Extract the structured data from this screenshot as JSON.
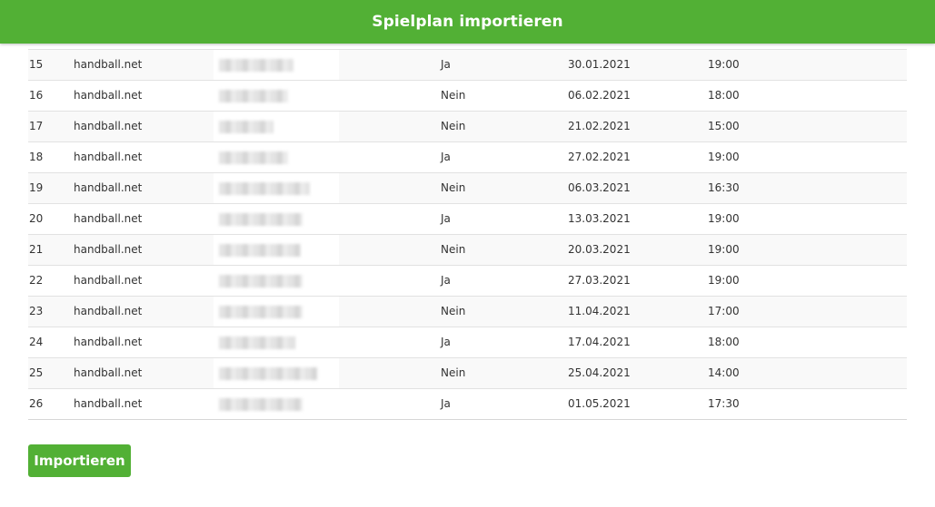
{
  "header": {
    "title": "Spielplan importieren"
  },
  "rows": [
    {
      "nr": "15",
      "source": "handball.net",
      "home": "Ja",
      "date": "30.01.2021",
      "time": "19:00"
    },
    {
      "nr": "16",
      "source": "handball.net",
      "home": "Nein",
      "date": "06.02.2021",
      "time": "18:00"
    },
    {
      "nr": "17",
      "source": "handball.net",
      "home": "Nein",
      "date": "21.02.2021",
      "time": "15:00"
    },
    {
      "nr": "18",
      "source": "handball.net",
      "home": "Ja",
      "date": "27.02.2021",
      "time": "19:00"
    },
    {
      "nr": "19",
      "source": "handball.net",
      "home": "Nein",
      "date": "06.03.2021",
      "time": "16:30"
    },
    {
      "nr": "20",
      "source": "handball.net",
      "home": "Ja",
      "date": "13.03.2021",
      "time": "19:00"
    },
    {
      "nr": "21",
      "source": "handball.net",
      "home": "Nein",
      "date": "20.03.2021",
      "time": "19:00"
    },
    {
      "nr": "22",
      "source": "handball.net",
      "home": "Ja",
      "date": "27.03.2021",
      "time": "19:00"
    },
    {
      "nr": "23",
      "source": "handball.net",
      "home": "Nein",
      "date": "11.04.2021",
      "time": "17:00"
    },
    {
      "nr": "24",
      "source": "handball.net",
      "home": "Ja",
      "date": "17.04.2021",
      "time": "18:00"
    },
    {
      "nr": "25",
      "source": "handball.net",
      "home": "Nein",
      "date": "25.04.2021",
      "time": "14:00"
    },
    {
      "nr": "26",
      "source": "handball.net",
      "home": "Ja",
      "date": "01.05.2021",
      "time": "17:30"
    }
  ],
  "footer": {
    "import_label": "Importieren"
  },
  "colors": {
    "accent": "#52b035"
  }
}
